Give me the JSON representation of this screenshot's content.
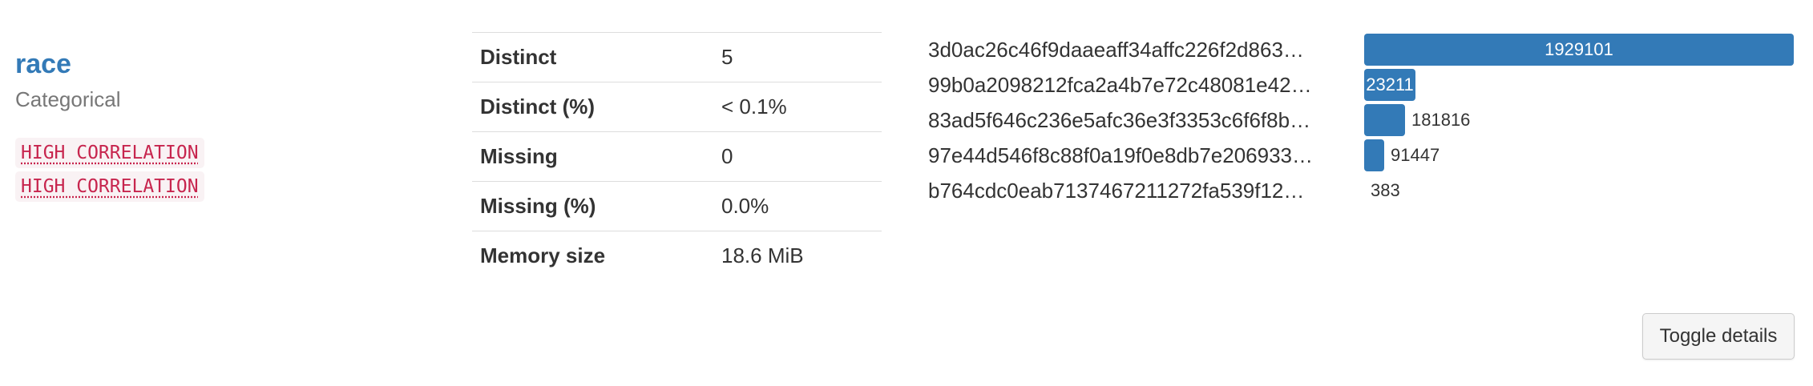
{
  "variable": {
    "name": "race",
    "type": "Categorical",
    "alerts": [
      "HIGH CORRELATION",
      "HIGH CORRELATION"
    ]
  },
  "stats": [
    {
      "label": "Distinct",
      "value": "5"
    },
    {
      "label": "Distinct (%)",
      "value": "< 0.1%"
    },
    {
      "label": "Missing",
      "value": "0"
    },
    {
      "label": "Missing (%)",
      "value": "0.0%"
    },
    {
      "label": "Memory size",
      "value": "18.6 MiB"
    }
  ],
  "frequencies": {
    "max": 1929101,
    "accent_color": "#337ab7",
    "rows": [
      {
        "label": "3d0ac26c46f9daaeaff34affc226f2d863…",
        "count": 1929101,
        "display": "1929101"
      },
      {
        "label": "99b0a2098212fca2a4b7e72c48081e42…",
        "count": 232110,
        "display": "23211"
      },
      {
        "label": "83ad5f646c236e5afc36e3f3353c6f6f8b…",
        "count": 181816,
        "display": "181816"
      },
      {
        "label": "97e44d546f8c88f0a19f0e8db7e206933…",
        "count": 91447,
        "display": "91447"
      },
      {
        "label": "b764cdc0eab7137467211272fa539f12…",
        "count": 383,
        "display": "383"
      }
    ]
  },
  "toggle_label": "Toggle details"
}
